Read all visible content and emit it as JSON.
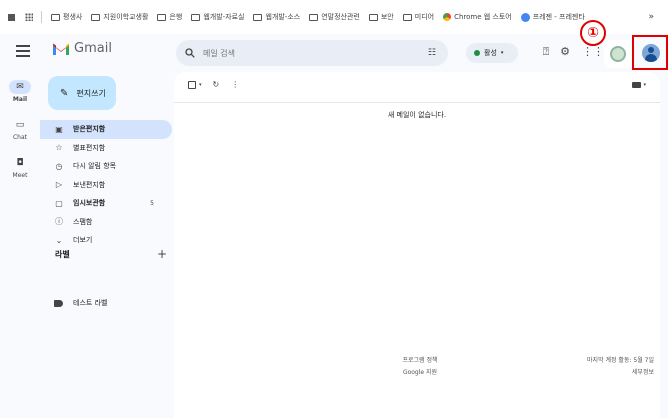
{
  "bookmarks": {
    "items": [
      "평생사",
      "지원이학교생활",
      "은행",
      "웹개발-자료실",
      "웹개발-소스",
      "연말정산관련",
      "보안",
      "미디어"
    ],
    "chrome_store": "Chrome 웹 스토어",
    "last": "프레젠 - 프레젠타",
    "more": "»"
  },
  "app": {
    "name": "Gmail"
  },
  "search": {
    "placeholder": "메일 검색",
    "filter_icon": "tune-icon"
  },
  "status": {
    "label": "활성"
  },
  "annotation": {
    "marker": "①"
  },
  "rail": [
    {
      "label": "Mail",
      "icon": "✉"
    },
    {
      "label": "Chat",
      "icon": "▭"
    },
    {
      "label": "Meet",
      "icon": "◘"
    }
  ],
  "compose": {
    "label": "편지쓰기"
  },
  "nav": [
    {
      "label": "받은편지함",
      "icon": "▣",
      "active": true,
      "bold": true,
      "count": ""
    },
    {
      "label": "별표편지함",
      "icon": "☆",
      "active": false,
      "bold": false,
      "count": ""
    },
    {
      "label": "다시 알림 항목",
      "icon": "◷",
      "active": false,
      "bold": false,
      "count": ""
    },
    {
      "label": "보낸편지함",
      "icon": "▷",
      "active": false,
      "bold": false,
      "count": ""
    },
    {
      "label": "임시보관함",
      "icon": "▢",
      "active": false,
      "bold": true,
      "count": "5"
    },
    {
      "label": "스팸함",
      "icon": "ⓘ",
      "active": false,
      "bold": false,
      "count": ""
    },
    {
      "label": "더보기",
      "icon": "⌄",
      "active": false,
      "bold": false,
      "count": ""
    }
  ],
  "labels": {
    "title": "라벨",
    "add": "+",
    "items": [
      "테스트 라벨"
    ]
  },
  "main": {
    "empty_message": "새 메일이 없습니다.",
    "footer_program": "프로그램 정책",
    "footer_terms": "Google 지원",
    "footer_activity": "마지막 계정 활동: 5월 7일",
    "footer_details": "세부정보"
  },
  "colors": {
    "accent": "#c2e7ff",
    "active_nav": "#d3e3fd",
    "highlight": "#e00000",
    "background": "#f8fafd"
  }
}
